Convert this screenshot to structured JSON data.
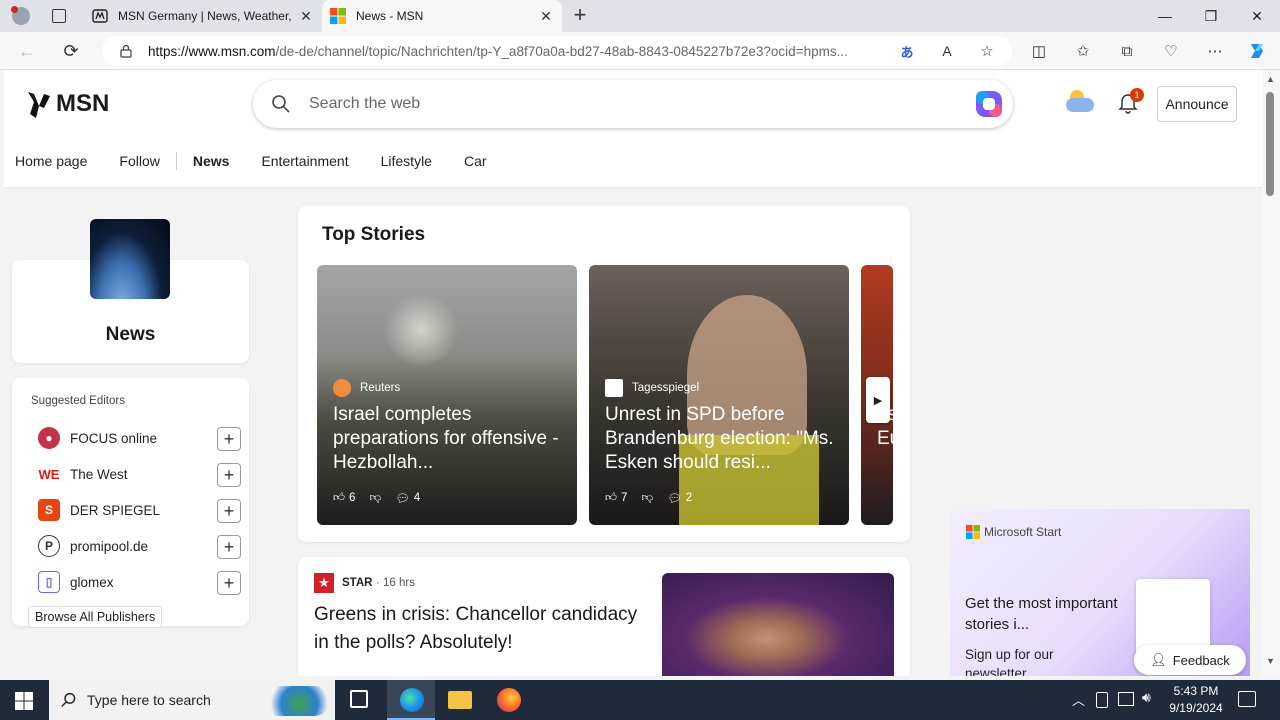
{
  "browser": {
    "tabs": [
      {
        "title": "MSN Germany | News, Weather, ",
        "active": false
      },
      {
        "title": "News - MSN",
        "active": true
      }
    ],
    "url_host": "https://www.msn.com",
    "url_path": "/de-de/channel/topic/Nachrichten/tp-Y_a8f70a0a-bd27-48ab-8843-0845227b72e3?ocid=hpms..."
  },
  "header": {
    "logo_text": "MSN",
    "search_placeholder": "Search the web",
    "notification_count": "1",
    "announce_label": "Announce"
  },
  "nav": {
    "items": [
      "Home page",
      "Follow",
      "News",
      "Entertainment",
      "Lifestyle",
      "Car"
    ]
  },
  "channel": {
    "title": "News"
  },
  "editors": {
    "heading": "Suggested Editors",
    "items": [
      "FOCUS online",
      "The West",
      "DER SPIEGEL",
      "promipool.de",
      "glomex"
    ],
    "browse_label": "Browse All Publishers"
  },
  "top_stories": {
    "heading": "Top Stories",
    "stories": [
      {
        "source": "Reuters",
        "headline": "Israel completes preparations for offensive - Hezbollah...",
        "likes": "6",
        "comments": "4"
      },
      {
        "source": "Tagesspiegel",
        "headline": "Unrest in SPD before Brandenburg election: \"Ms. Esken should resi...",
        "likes": "7",
        "comments": "2"
      },
      {
        "source": "",
        "headline": "as Eu",
        "likes": "",
        "comments": ""
      }
    ]
  },
  "article": {
    "source": "STAR",
    "time": "· 16 hrs",
    "headline": "Greens in crisis: Chancellor candidacy in the polls? Absolutely!"
  },
  "promo": {
    "brand": "Microsoft Start",
    "title": "Get the most important stories i...",
    "sub": "Sign up for our newsletter",
    "feedback": "Feedback"
  },
  "taskbar": {
    "search_placeholder": "Type here to search",
    "time": "5:43 PM",
    "date": "9/19/2024"
  },
  "colors": {
    "accent": "#0078d4",
    "notification": "#d83b01"
  }
}
